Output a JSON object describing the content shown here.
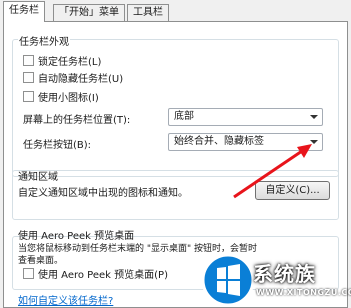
{
  "tabs": [
    "任务栏",
    "「开始」菜单",
    "工具栏"
  ],
  "appearance": {
    "title": "任务栏外观",
    "lock": "锁定任务栏(L)",
    "autohide": "自动隐藏任务栏(U)",
    "small_icons": "使用小图标(I)",
    "location_label": "屏幕上的任务栏位置(T):",
    "location_value": "底部",
    "buttons_label": "任务栏按钮(B):",
    "buttons_value": "始终合并、隐藏标签"
  },
  "notification": {
    "title": "通知区域",
    "desc": "自定义通知区域中出现的图标和通知。",
    "customize_button": "自定义(C)..."
  },
  "aero": {
    "title": "使用 Aero Peek 预览桌面",
    "desc_line1": "当您将鼠标移动到任务栏末端的 \"显示桌面\" 按钮时，会暂时",
    "desc_line2": "查看桌面。",
    "checkbox": "使用 Aero Peek 预览桌面(P)"
  },
  "help_link": "如何自定义该任务栏?",
  "watermark": {
    "text": "系统族",
    "url": "WWW.XITONGZU.COM"
  },
  "colors": {
    "annotation_arrow": "#e8141b",
    "link": "#0066cc"
  }
}
